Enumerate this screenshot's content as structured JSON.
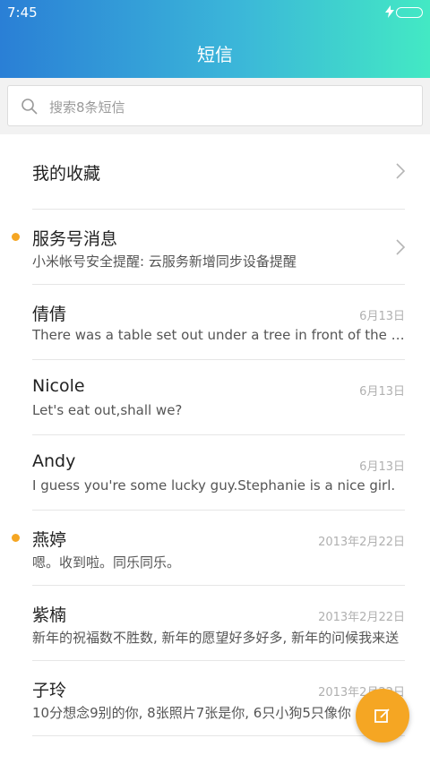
{
  "status_bar": {
    "time": "7:45",
    "charging_icon": "lightning-icon",
    "battery_icon": "battery-icon"
  },
  "header": {
    "title": "短信"
  },
  "search": {
    "placeholder": "搜索8条短信"
  },
  "favorites": {
    "label": "我的收藏"
  },
  "conversations": [
    {
      "name": "服务号消息",
      "preview": "小米帐号安全提醒: 云服务新增同步设备提醒",
      "date": "",
      "unread": true,
      "has_chevron": true
    },
    {
      "name": "倩倩",
      "preview": "There was a table set out under a tree in front of the house",
      "date": "6月13日",
      "unread": false
    },
    {
      "name": "Nicole",
      "preview": "Let's eat out,shall we?",
      "date": "6月13日",
      "unread": false
    },
    {
      "name": "Andy",
      "preview": "I guess you're some lucky guy.Stephanie is a nice girl.",
      "date": "6月13日",
      "unread": false
    },
    {
      "name": "燕婷",
      "preview": "嗯。收到啦。同乐同乐。",
      "date": "2013年2月22日",
      "unread": true
    },
    {
      "name": "紫楠",
      "preview": "新年的祝福数不胜数, 新年的愿望好多好多, 新年的问候我来送",
      "date": "2013年2月22日",
      "unread": false
    },
    {
      "name": "子玲",
      "preview": "10分想念9别的你, 8张照片7张是你, 6只小狗5只像你",
      "date": "2013年2月22日",
      "unread": false
    }
  ],
  "fab": {
    "icon": "compose-icon"
  },
  "colors": {
    "accent": "#f5a623",
    "header_start": "#2a7fd6",
    "header_end": "#43e9c4"
  }
}
